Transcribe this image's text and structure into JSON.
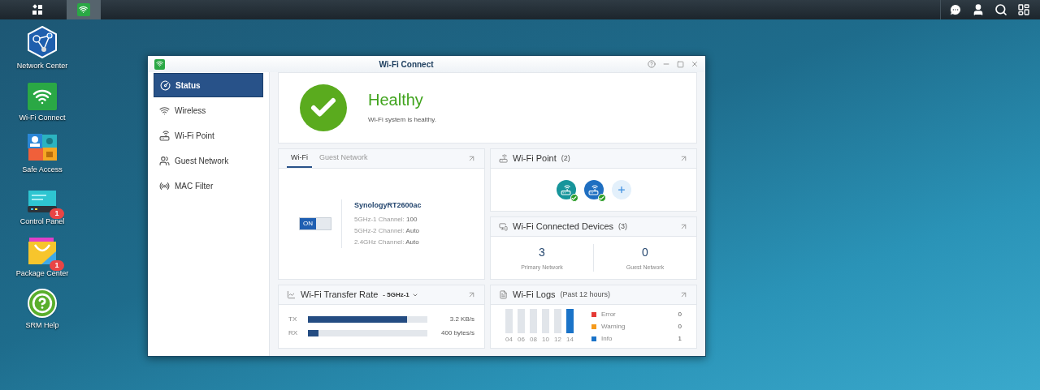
{
  "taskbar": {
    "buttons": [
      {
        "kind": "main-menu",
        "selected": false
      },
      {
        "kind": "wifi-app",
        "selected": true
      }
    ]
  },
  "desktop_icons": [
    {
      "kind": "network",
      "label": "Network Center"
    },
    {
      "kind": "wifi",
      "label": "Wi-Fi Connect"
    },
    {
      "kind": "safe",
      "label": "Safe Access"
    },
    {
      "kind": "control",
      "label": "Control Panel",
      "badge": "1"
    },
    {
      "kind": "package",
      "label": "Package Center",
      "badge": "1"
    },
    {
      "kind": "help",
      "label": "SRM Help"
    }
  ],
  "window": {
    "title": "Wi-Fi Connect"
  },
  "sidebar": {
    "items": [
      {
        "kind": "status",
        "label": "Status",
        "selected": true
      },
      {
        "kind": "wireless",
        "label": "Wireless",
        "selected": false
      },
      {
        "kind": "point",
        "label": "Wi-Fi Point",
        "selected": false
      },
      {
        "kind": "guest",
        "label": "Guest Network",
        "selected": false
      },
      {
        "kind": "mac",
        "label": "MAC Filter",
        "selected": false
      }
    ]
  },
  "status": {
    "title": "Healthy",
    "message": "Wi-Fi system is healthy."
  },
  "wifi_card": {
    "tabs": [
      {
        "label": "Wi-Fi",
        "selected": true
      },
      {
        "label": "Guest Network",
        "selected": false
      }
    ],
    "switch": {
      "label": "ON",
      "on": true
    },
    "ssid": "SynologyRT2600ac",
    "channels": [
      {
        "label": "5GHz-1 Channel:",
        "value": "100"
      },
      {
        "label": "5GHz-2 Channel:",
        "value": "Auto"
      },
      {
        "label": "2.4GHz Channel:",
        "value": "Auto"
      }
    ]
  },
  "wifi_points": {
    "title": "Wi-Fi Point",
    "count": "(2)",
    "points": [
      {
        "color": "#17959b",
        "online": true
      },
      {
        "color": "#1f6fc1",
        "online": true
      }
    ]
  },
  "connected_devices": {
    "title": "Wi-Fi Connected Devices",
    "count": "(3)",
    "stats": [
      {
        "value": "3",
        "label": "Primary Network"
      },
      {
        "value": "0",
        "label": "Guest Network"
      }
    ]
  },
  "transfer": {
    "title": "Wi-Fi Transfer Rate",
    "band": "- 5GHz-1",
    "rows": [
      {
        "label": "TX",
        "level": 0.83,
        "reading": "3.2 KB/s"
      },
      {
        "label": "RX",
        "level": 0.09,
        "reading": "400 bytes/s"
      }
    ]
  },
  "logs": {
    "title": "Wi-Fi Logs",
    "period": "(Past 12 hours)",
    "bars": [
      {
        "label": "04",
        "level": 0
      },
      {
        "label": "06",
        "level": 0
      },
      {
        "label": "08",
        "level": 0
      },
      {
        "label": "10",
        "level": 0
      },
      {
        "label": "12",
        "level": 0
      },
      {
        "label": "14",
        "level": 1
      }
    ],
    "legend": [
      {
        "label": "Error",
        "color": "#e53935",
        "count": "0"
      },
      {
        "label": "Warning",
        "color": "#f59a1c",
        "count": "0"
      },
      {
        "label": "Info",
        "color": "#1a73c8",
        "count": "1"
      }
    ]
  }
}
